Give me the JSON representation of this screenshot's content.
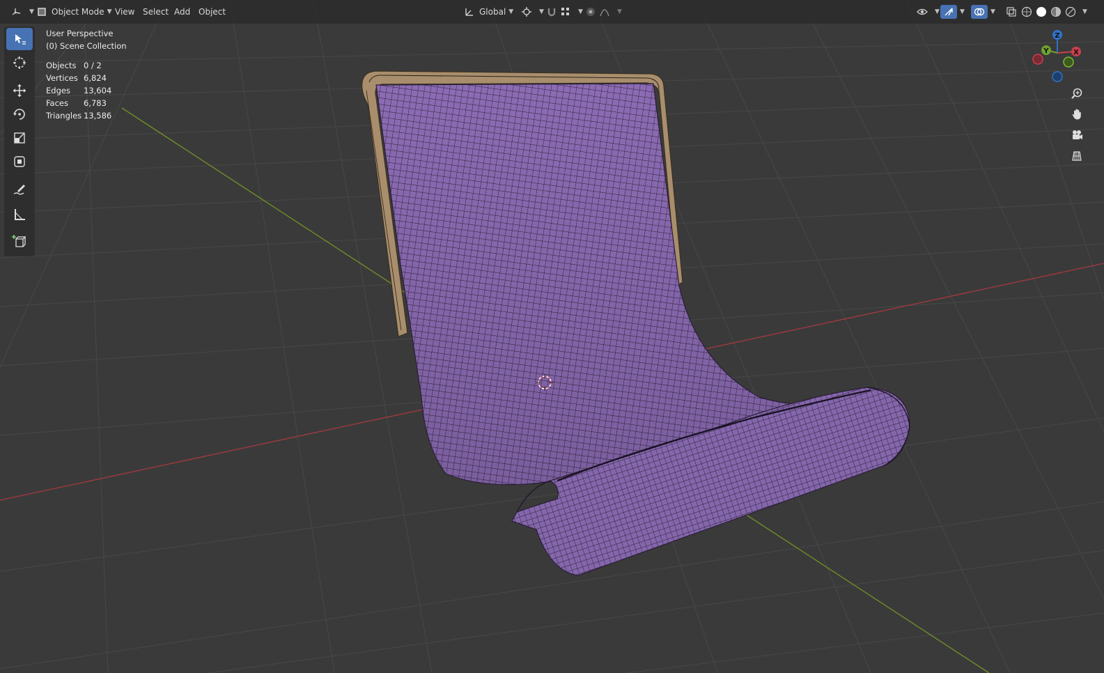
{
  "header": {
    "editor_type_icon": "3d-viewport-icon",
    "mode": {
      "label": "Object Mode",
      "icon": "object-mode-icon"
    },
    "menus": [
      "View",
      "Select",
      "Add",
      "Object"
    ],
    "transform_orientation": {
      "label": "Global",
      "icon": "orientation-global-icon"
    },
    "pivot_icon": "pivot-point-icon",
    "snap_icon": "snap-magnet-icon",
    "snap_increment_icon": "snap-increment-icon",
    "proportional_icon": "proportional-editing-icon",
    "falloff_icon": "falloff-curve-icon",
    "visibility_icon": "eye-visibility-icon",
    "gizmo_icon": "gizmo-icon",
    "overlay_icon": "overlay-icon",
    "xray_icon": "xray-toggle-icon",
    "shading_modes": [
      "wireframe-shading-icon",
      "solid-shading-icon",
      "material-shading-icon",
      "rendered-shading-icon"
    ]
  },
  "toolbar": {
    "tools": [
      {
        "name": "select-box-tool",
        "icon": "select-box-icon",
        "active": true
      },
      {
        "name": "cursor-tool",
        "icon": "cursor-icon",
        "active": false
      },
      {
        "name": "move-tool",
        "icon": "move-icon",
        "active": false
      },
      {
        "name": "rotate-tool",
        "icon": "rotate-icon",
        "active": false
      },
      {
        "name": "scale-tool",
        "icon": "scale-icon",
        "active": false
      },
      {
        "name": "transform-tool",
        "icon": "transform-icon",
        "active": false
      },
      {
        "name": "annotate-tool",
        "icon": "annotate-icon",
        "active": false
      },
      {
        "name": "measure-tool",
        "icon": "measure-icon",
        "active": false
      },
      {
        "name": "add-cube-tool",
        "icon": "add-cube-icon",
        "active": false
      }
    ]
  },
  "overlay": {
    "view_name": "User Perspective",
    "collection": "(0) Scene Collection",
    "stats": [
      {
        "label": "Objects",
        "value": "0 / 2"
      },
      {
        "label": "Vertices",
        "value": "6,824"
      },
      {
        "label": "Edges",
        "value": "13,604"
      },
      {
        "label": "Faces",
        "value": "6,783"
      },
      {
        "label": "Triangles",
        "value": "13,586"
      }
    ]
  },
  "nav_gizmo": {
    "x_label": "X",
    "y_label": "Y",
    "z_label": "Z"
  },
  "nav_buttons": [
    "zoom-icon",
    "pan-hand-icon",
    "camera-view-icon",
    "orthographic-grid-icon"
  ],
  "colors": {
    "background": "#3a3a3a",
    "grid": "#464646",
    "x_axis": "#a0393f",
    "y_axis": "#6e8f28",
    "mesh_fill": "#8b6bb3",
    "mesh_wire": "#2a1f36",
    "frame": "#a88e6c",
    "active_tool": "#4772b3"
  }
}
